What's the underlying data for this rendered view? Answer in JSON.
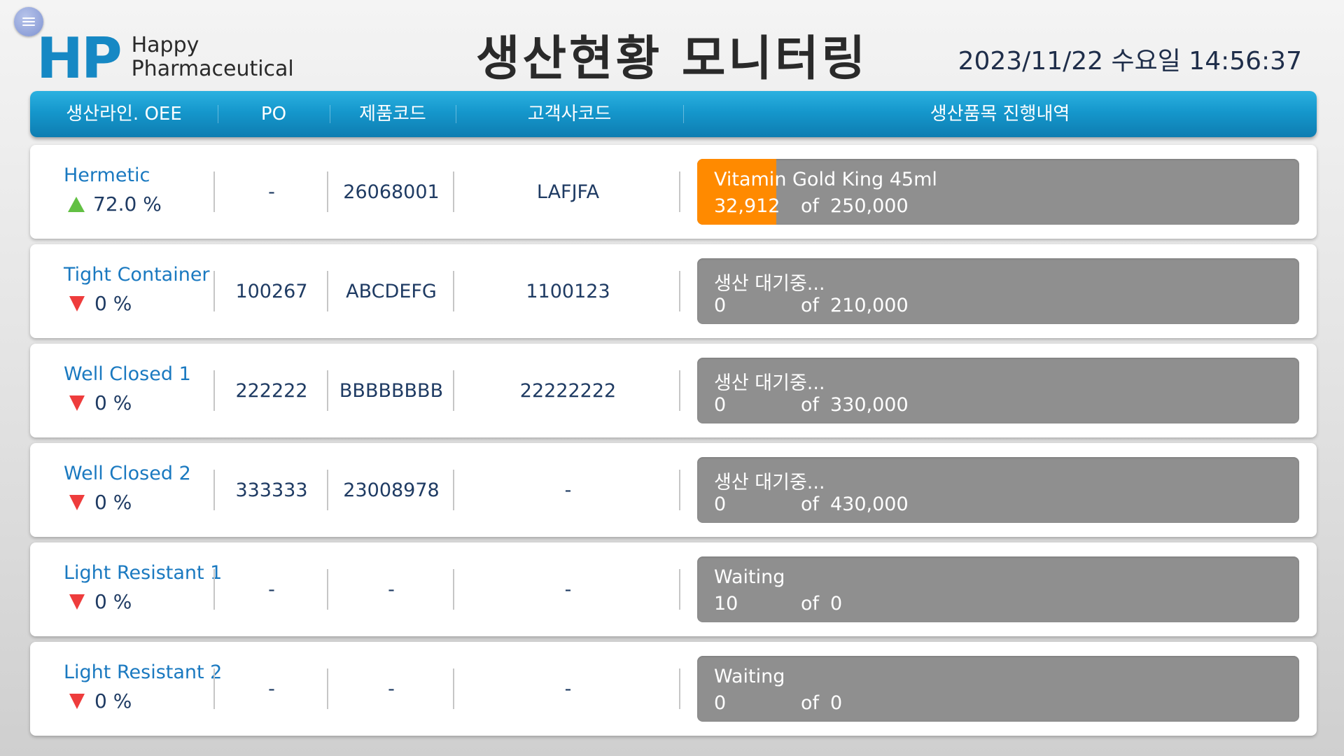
{
  "logo": {
    "mark": "HP",
    "line1": "Happy",
    "line2": "Pharmaceutical"
  },
  "title": "생산현황 모니터링",
  "datetime": "2023/11/22  수요일 14:56:37",
  "headers": {
    "line_oee": "생산라인. OEE",
    "po": "PO",
    "product_code": "제품코드",
    "customer_code": "고객사코드",
    "progress": "생산품목 진행내역"
  },
  "rows": [
    {
      "line": "Hermetic",
      "trend": "up",
      "oee": "72.0 %",
      "po": "-",
      "product_code": "26068001",
      "customer_code": "LAFJFA",
      "item": "Vitamin Gold King 45ml",
      "produced": "32,912",
      "of": "of",
      "target": "250,000",
      "progress": 0.1317
    },
    {
      "line": "Tight Container",
      "trend": "down",
      "oee": "0 %",
      "po": "100267",
      "product_code": "ABCDEFG",
      "customer_code": "1100123",
      "item": "생산 대기중...",
      "produced": "0",
      "of": "of",
      "target": "210,000",
      "progress": 0
    },
    {
      "line": "Well Closed 1",
      "trend": "down",
      "oee": "0 %",
      "po": "222222",
      "product_code": "BBBBBBBB",
      "customer_code": "22222222",
      "item": "생산 대기중...",
      "produced": "0",
      "of": "of",
      "target": "330,000",
      "progress": 0
    },
    {
      "line": "Well Closed 2",
      "trend": "down",
      "oee": "0 %",
      "po": "333333",
      "product_code": "23008978",
      "customer_code": "-",
      "item": "생산 대기중...",
      "produced": "0",
      "of": "of",
      "target": "430,000",
      "progress": 0
    },
    {
      "line": "Light Resistant 1",
      "trend": "down",
      "oee": "0 %",
      "po": "-",
      "product_code": "-",
      "customer_code": "-",
      "item": "Waiting",
      "produced": "10",
      "of": "of",
      "target": "0",
      "progress": 0
    },
    {
      "line": "Light Resistant 2",
      "trend": "down",
      "oee": "0 %",
      "po": "-",
      "product_code": "-",
      "customer_code": "-",
      "item": "Waiting",
      "produced": "0",
      "of": "of",
      "target": "0",
      "progress": 0
    }
  ],
  "colors": {
    "accent": "#1688c4",
    "progress_fill": "#ff8a00",
    "progress_bg": "#8f8f8f",
    "trend_up": "#62c043",
    "trend_down": "#ee3c3c"
  }
}
